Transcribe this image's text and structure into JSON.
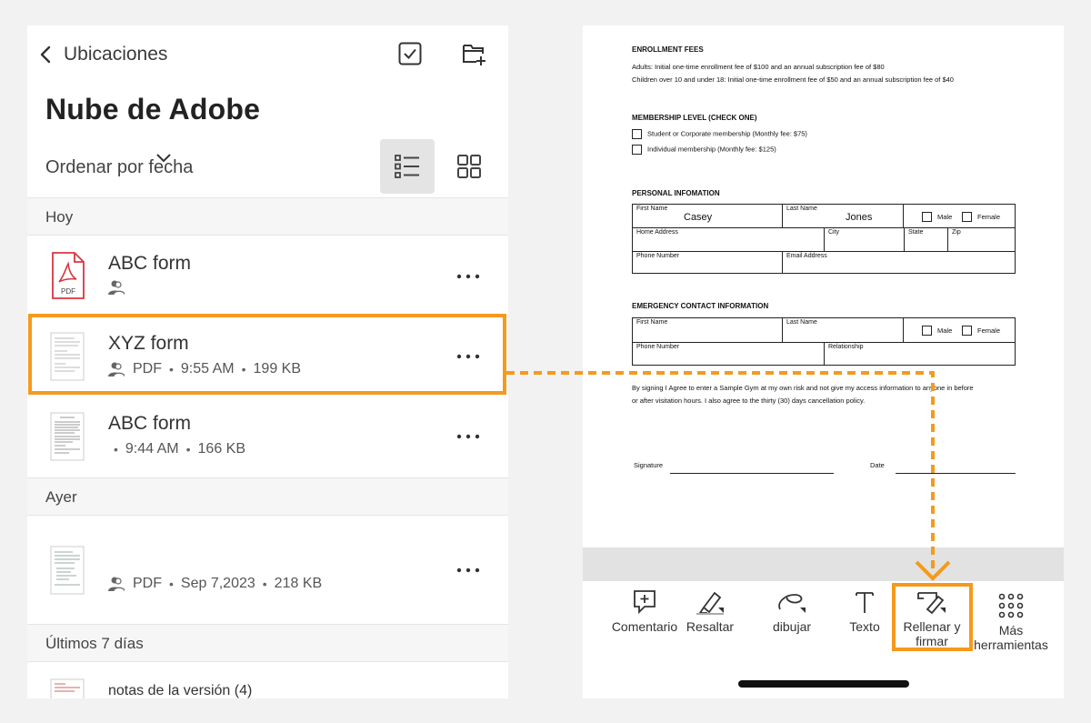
{
  "left": {
    "back_label": "Ubicaciones",
    "title": "Nube de Adobe",
    "sort_label": "Ordenar por fecha",
    "sections": {
      "today": "Hoy",
      "yesterday": "Ayer",
      "last7": "Últimos 7 días"
    },
    "files": [
      {
        "name": "ABC form",
        "type": "",
        "time": "",
        "size": ""
      },
      {
        "name": "XYZ form",
        "type": "PDF",
        "time": "9:55 AM",
        "size": "199 KB"
      },
      {
        "name": "ABC form",
        "type": "",
        "time": "9:44 AM",
        "size": "166 KB"
      },
      {
        "name": "",
        "type": "PDF",
        "time": "Sep 7,2023",
        "size": "218 KB"
      },
      {
        "name": "notas de la versión (4)"
      }
    ],
    "pdf_icon_text": "PDF"
  },
  "doc": {
    "enroll_h": "ENROLLMENT FEES",
    "enroll_1": "Adults: Initial one-time enrollment fee of $100 and an annual subscription fee of $80",
    "enroll_2": "Children over 10 and under 18: Initial one-time enrollment fee of $50 and an annual subscription fee of $40",
    "member_h": "MEMBERSHIP LEVEL (CHECK ONE)",
    "member_1": "Student or Corporate membership (Monthly fee: $75)",
    "member_2": "Individual membership (Monthly fee: $125)",
    "personal_h": "PERSONAL INFOMATION",
    "first_name": "First Name",
    "last_name": "Last Name",
    "first_value": "Casey",
    "last_value": "Jones",
    "male": "Male",
    "female": "Female",
    "home": "Home Address",
    "city": "City",
    "state": "State",
    "zip": "Zip",
    "phone": "Phone Number",
    "email": "Email Address",
    "emergency_h": "EMERGENCY CONTACT INFORMATION",
    "relationship": "Relationship",
    "agree_1": "By signing I Agree to enter a Sample Gym at my own risk and not give my access information to anyone in before",
    "agree_2": "or after visitation hours. I also agree to the thirty (30) days cancellation policy.",
    "signature": "Signature",
    "date": "Date"
  },
  "toolbar": {
    "comment": "Comentario",
    "highlight": "Resaltar",
    "draw": "dibujar",
    "text": "Texto",
    "fill_1": "Rellenar y",
    "fill_2": "firmar",
    "more_1": "Más",
    "more_2": "herramientas"
  },
  "colors": {
    "accent": "#f59a1b",
    "pdf_red": "#d7373f"
  }
}
